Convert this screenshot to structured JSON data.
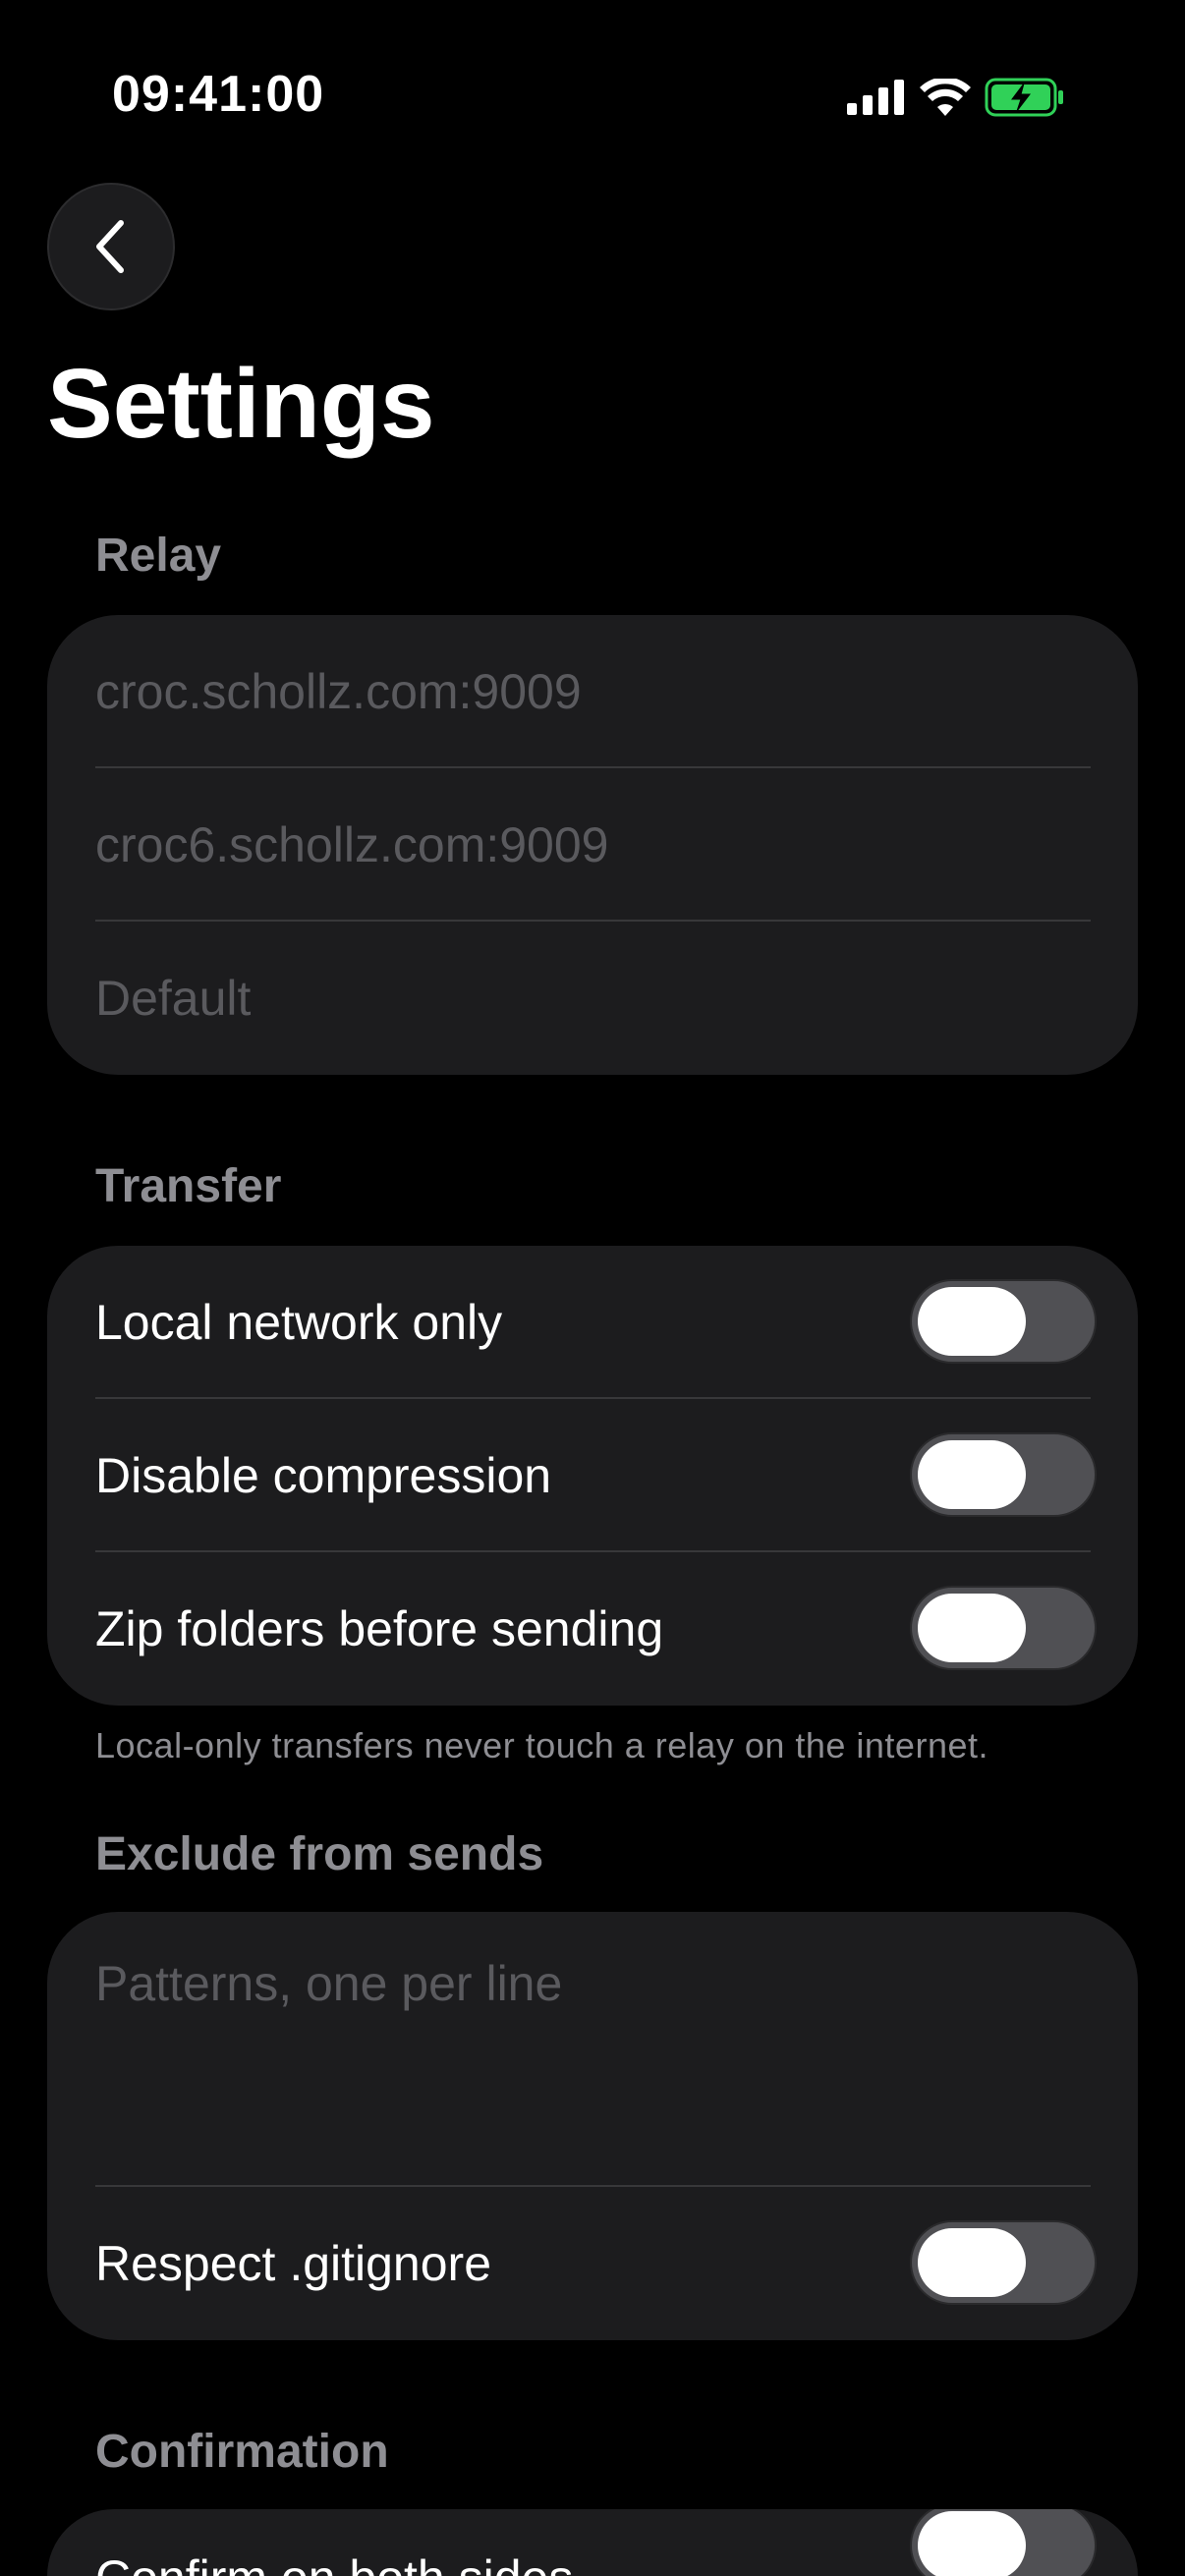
{
  "status_bar": {
    "time": "09:41:00",
    "icons": [
      "cellular-signal-icon",
      "wifi-icon",
      "battery-charging-icon"
    ],
    "battery_color": "#30d158"
  },
  "nav": {
    "back_icon": "chevron-left-icon"
  },
  "title": "Settings",
  "relay": {
    "header": "Relay",
    "fields": [
      {
        "placeholder": "croc.schollz.com:9009",
        "value": ""
      },
      {
        "placeholder": "croc6.schollz.com:9009",
        "value": ""
      },
      {
        "placeholder": "Default",
        "value": ""
      }
    ]
  },
  "transfer": {
    "header": "Transfer",
    "toggles": [
      {
        "label": "Local network only",
        "on": false
      },
      {
        "label": "Disable compression",
        "on": false
      },
      {
        "label": "Zip folders before sending",
        "on": false
      }
    ],
    "footnote": "Local-only transfers never touch a relay on the internet."
  },
  "exclude": {
    "header": "Exclude from sends",
    "patterns_placeholder": "Patterns, one per line",
    "patterns_value": "",
    "toggle": {
      "label": "Respect .gitignore",
      "on": false
    }
  },
  "confirmation": {
    "header": "Confirmation",
    "toggles": [
      {
        "label": "Confirm on both sides",
        "on": false
      }
    ]
  },
  "colors": {
    "background": "#000000",
    "card": "#1c1c1e",
    "secondary_text": "#8e8e93",
    "toggle_off_track": "#505054"
  }
}
